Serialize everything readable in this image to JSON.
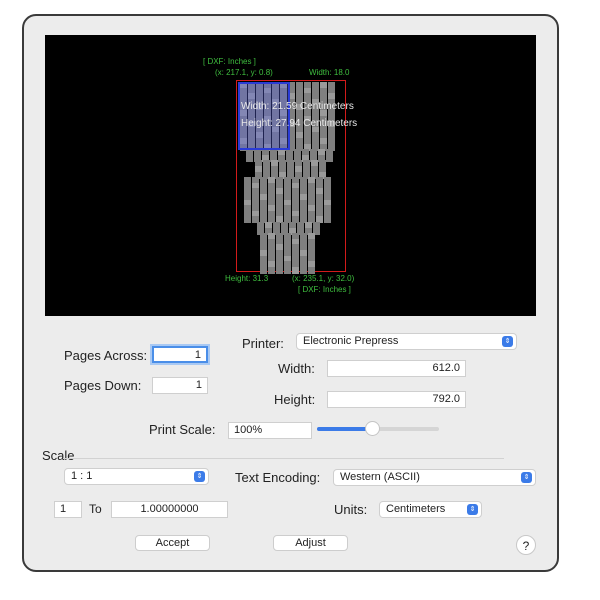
{
  "preview": {
    "top_dxf_label": "[ DXF: Inches ]",
    "top_coords": "(x: 217.1, y: 0.8)",
    "width_readout": "Width: 18.0",
    "page_width_text": "Width: 21.59 Centimeters",
    "page_height_text": "Height: 27.94 Centimeters",
    "height_readout": "Height: 31.3",
    "bottom_coords": "(x: 235.1, y: 32.0)",
    "bottom_dxf_label": "[ DXF: Inches ]"
  },
  "pages_across": {
    "label": "Pages Across:",
    "value": "1"
  },
  "pages_down": {
    "label": "Pages Down:",
    "value": "1"
  },
  "printer": {
    "label": "Printer:",
    "value": "Electronic Prepress"
  },
  "width": {
    "label": "Width:",
    "value": "612.0"
  },
  "height": {
    "label": "Height:",
    "value": "792.0"
  },
  "print_scale": {
    "label": "Print Scale:",
    "value": "100%",
    "slider_level": 0.5
  },
  "scale": {
    "section_label": "Scale",
    "ratio": "1 : 1",
    "from": "1",
    "to_label": "To",
    "to_value": "1.00000000"
  },
  "text_encoding": {
    "label": "Text Encoding:",
    "value": "Western (ASCII)"
  },
  "units": {
    "label": "Units:",
    "value": "Centimeters"
  },
  "buttons": {
    "accept": "Accept",
    "adjust": "Adjust",
    "help": "?"
  },
  "colors": {
    "accent": "#3b7be8",
    "preview_bg": "#000000",
    "guide_text": "#3fbf3f",
    "red_outline": "#d21b1b",
    "blue_outline": "#2a3bd6"
  }
}
